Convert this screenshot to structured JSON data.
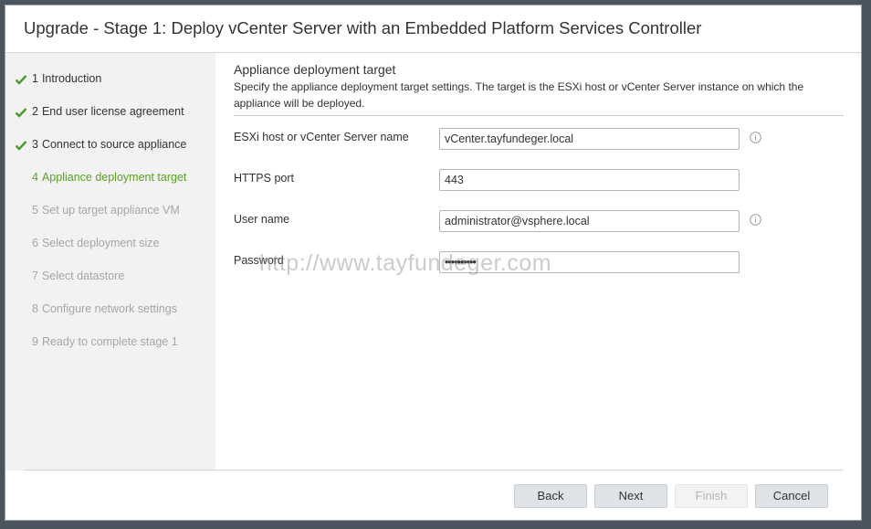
{
  "dialog": {
    "title": "Upgrade - Stage 1: Deploy vCenter Server with an Embedded Platform Services Controller"
  },
  "steps": [
    {
      "number": "1",
      "label": "Introduction",
      "status": "done"
    },
    {
      "number": "2",
      "label": "End user license agreement",
      "status": "done"
    },
    {
      "number": "3",
      "label": "Connect to source appliance",
      "status": "done"
    },
    {
      "number": "4",
      "label": "Appliance deployment target",
      "status": "active"
    },
    {
      "number": "5",
      "label": "Set up target appliance VM",
      "status": "pending"
    },
    {
      "number": "6",
      "label": "Select deployment size",
      "status": "pending"
    },
    {
      "number": "7",
      "label": "Select datastore",
      "status": "pending"
    },
    {
      "number": "8",
      "label": "Configure network settings",
      "status": "pending"
    },
    {
      "number": "9",
      "label": "Ready to complete stage 1",
      "status": "pending"
    }
  ],
  "section": {
    "title": "Appliance deployment target",
    "description": "Specify the appliance deployment target settings. The target is the ESXi host or vCenter Server instance on which the appliance will be deployed."
  },
  "form": {
    "host_label": "ESXi host or vCenter Server name",
    "host_value": "vCenter.tayfundeger.local",
    "port_label": "HTTPS port",
    "port_value": "443",
    "user_label": "User name",
    "user_value": "administrator@vsphere.local",
    "password_label": "Password",
    "password_value": "••••••••••"
  },
  "watermark": "http://www.tayfundeger.com",
  "buttons": {
    "back": "Back",
    "next": "Next",
    "finish": "Finish",
    "cancel": "Cancel"
  },
  "colors": {
    "active_step": "#5aa220",
    "check": "#4d9a2a",
    "button_bg": "#dfe3e7"
  },
  "icons": {
    "step_done": "check-icon",
    "field_help": "info-icon"
  }
}
